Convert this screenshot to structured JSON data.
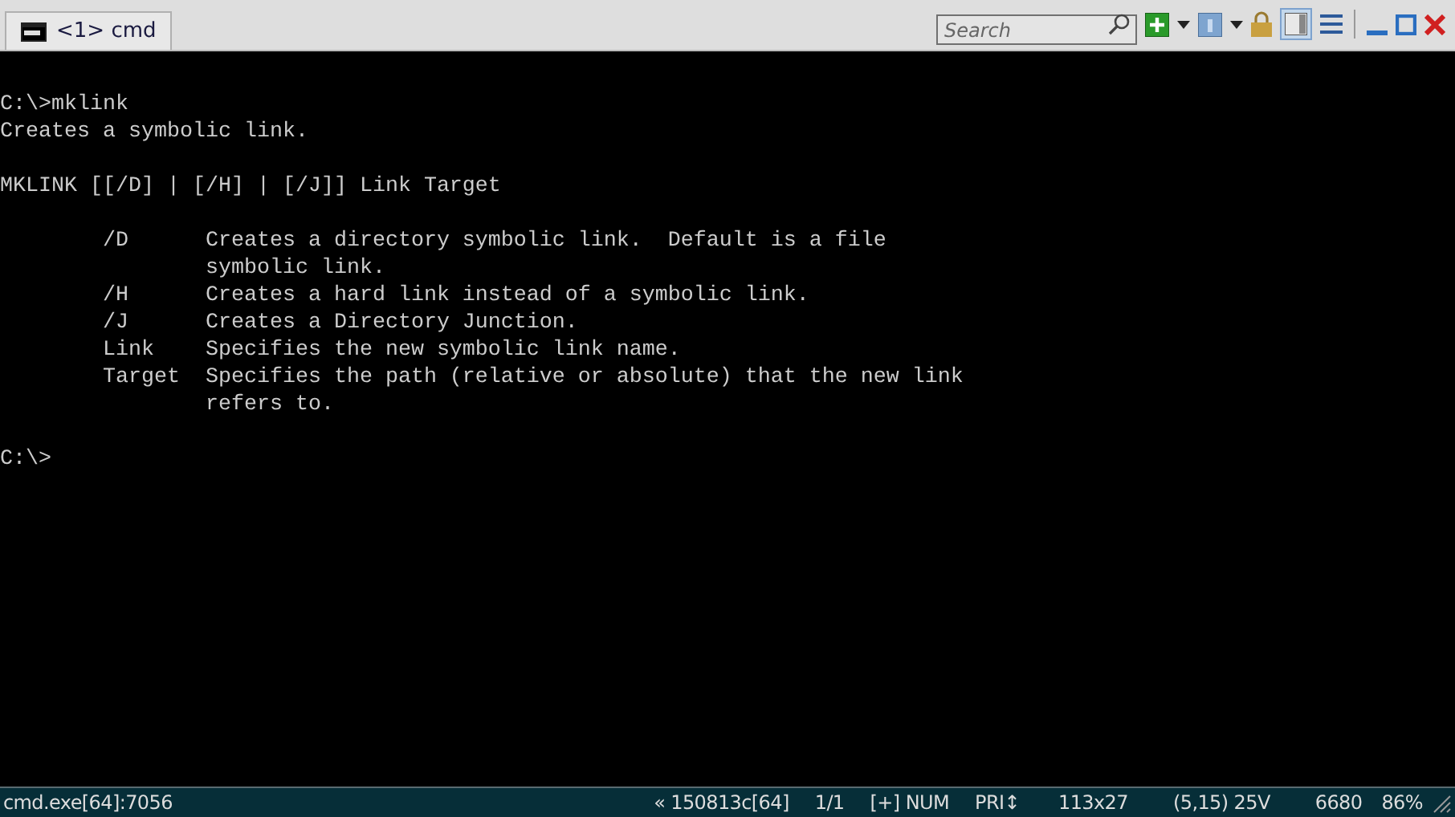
{
  "tab": {
    "label": "<1> cmd",
    "selected": true
  },
  "search": {
    "placeholder": "Search"
  },
  "console": {
    "paragraphs": [
      [
        "C:\\>mklink",
        "Creates a symbolic link."
      ],
      [
        "MKLINK [[/D] | [/H] | [/J]] Link Target"
      ],
      [
        "        /D      Creates a directory symbolic link.  Default is a file",
        "                symbolic link.",
        "        /H      Creates a hard link instead of a symbolic link.",
        "        /J      Creates a Directory Junction.",
        "        Link    Specifies the new symbolic link name.",
        "        Target  Specifies the path (relative or absolute) that the new link",
        "                refers to."
      ],
      [
        "C:\\>"
      ]
    ]
  },
  "status_bar": {
    "left": "cmd.exe[64]:7056",
    "items": [
      "« 150813c[64]",
      "1/1",
      "[+] NUM",
      "PRI↕",
      "113x27",
      "(5,15) 25V",
      "6680",
      "86%"
    ]
  }
}
